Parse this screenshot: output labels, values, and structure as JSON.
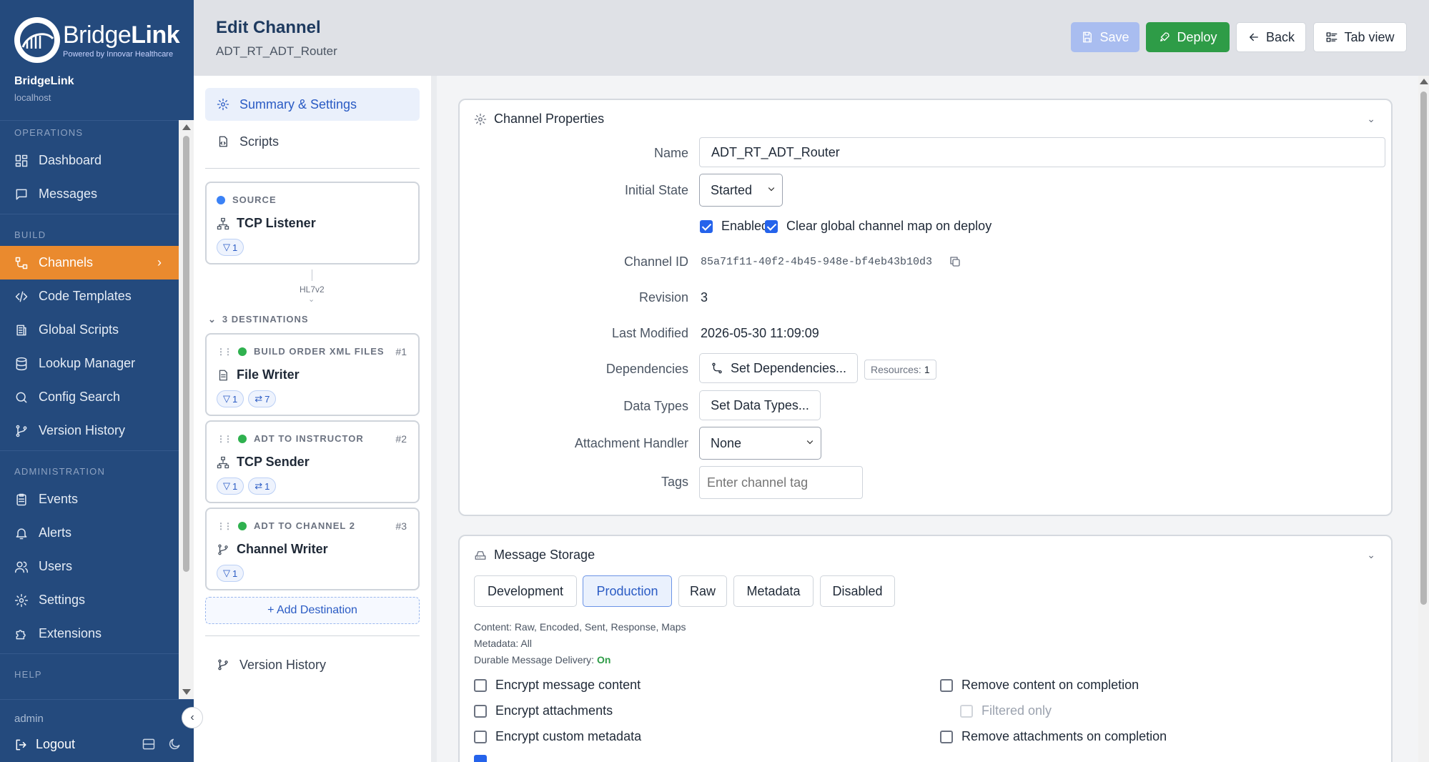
{
  "brand": {
    "name_light": "Bridge",
    "name_bold": "Link",
    "tagline": "Powered by Innovar Healthcare"
  },
  "server": {
    "name": "BridgeLink",
    "host": "localhost"
  },
  "sidebar": {
    "sections": [
      {
        "title": "OPERATIONS",
        "items": [
          {
            "label": "Dashboard",
            "icon": "dashboard-icon"
          },
          {
            "label": "Messages",
            "icon": "message-icon"
          }
        ]
      },
      {
        "title": "BUILD",
        "items": [
          {
            "label": "Channels",
            "icon": "channels-icon",
            "active": true
          },
          {
            "label": "Code Templates",
            "icon": "code-icon"
          },
          {
            "label": "Global Scripts",
            "icon": "script-icon"
          },
          {
            "label": "Lookup Manager",
            "icon": "database-icon"
          },
          {
            "label": "Config Search",
            "icon": "search-icon"
          },
          {
            "label": "Version History",
            "icon": "branch-icon"
          }
        ]
      },
      {
        "title": "ADMINISTRATION",
        "items": [
          {
            "label": "Events",
            "icon": "clipboard-icon"
          },
          {
            "label": "Alerts",
            "icon": "bell-icon"
          },
          {
            "label": "Users",
            "icon": "users-icon"
          },
          {
            "label": "Settings",
            "icon": "gear-icon"
          },
          {
            "label": "Extensions",
            "icon": "puzzle-icon"
          }
        ]
      },
      {
        "title": "HELP",
        "items": []
      }
    ],
    "user": "admin",
    "logout_label": "Logout"
  },
  "header": {
    "title": "Edit Channel",
    "subtitle": "ADT_RT_ADT_Router",
    "save_label": "Save",
    "deploy_label": "Deploy",
    "back_label": "Back",
    "tabview_label": "Tab view"
  },
  "middle": {
    "tabs": {
      "summary": "Summary & Settings",
      "scripts": "Scripts"
    },
    "source": {
      "kind": "SOURCE",
      "name": "TCP Listener",
      "filters": "1",
      "color": "#3b82f6"
    },
    "connector_label": "HL7v2",
    "destinations_header": "3 DESTINATIONS",
    "destinations": [
      {
        "kind": "BUILD ORDER XML FILES",
        "num": "#1",
        "name": "File Writer",
        "filters": "1",
        "transformers": "7",
        "color": "#2fb14f"
      },
      {
        "kind": "ADT TO INSTRUCTOR",
        "num": "#2",
        "name": "TCP Sender",
        "filters": "1",
        "transformers": "1",
        "color": "#2fb14f"
      },
      {
        "kind": "ADT TO CHANNEL 2",
        "num": "#3",
        "name": "Channel Writer",
        "filters": "1",
        "color": "#2fb14f"
      }
    ],
    "add_destination": "+ Add Destination",
    "version_history": "Version History"
  },
  "channel_properties": {
    "title": "Channel Properties",
    "name_label": "Name",
    "name_value": "ADT_RT_ADT_Router",
    "initial_state_label": "Initial State",
    "initial_state_value": "Started",
    "enabled_label": "Enabled",
    "enabled": true,
    "clear_map_label": "Clear global channel map on deploy",
    "clear_map": true,
    "channel_id_label": "Channel ID",
    "channel_id": "85a71f11-40f2-4b45-948e-bf4eb43b10d3",
    "revision_label": "Revision",
    "revision": "3",
    "last_modified_label": "Last Modified",
    "last_modified": "2026-05-30 11:09:09",
    "dependencies_label": "Dependencies",
    "set_dependencies": "Set Dependencies...",
    "resources_label": "Resources:",
    "resources_count": "1",
    "data_types_label": "Data Types",
    "set_data_types": "Set Data Types...",
    "attachment_label": "Attachment Handler",
    "attachment_value": "None",
    "tags_label": "Tags",
    "tags_placeholder": "Enter channel tag"
  },
  "message_storage": {
    "title": "Message Storage",
    "modes": [
      "Development",
      "Production",
      "Raw",
      "Metadata",
      "Disabled"
    ],
    "active_mode": "Production",
    "content_line": "Content: Raw, Encoded, Sent, Response, Maps",
    "metadata_line": "Metadata: All",
    "durable_label": "Durable Message Delivery:",
    "durable_value": "On",
    "options": {
      "encrypt_content": "Encrypt message content",
      "encrypt_attachments": "Encrypt attachments",
      "encrypt_metadata": "Encrypt custom metadata",
      "remove_content": "Remove content on completion",
      "filtered_only": "Filtered only",
      "remove_attachments": "Remove attachments on completion"
    }
  },
  "colors": {
    "sidebar_bg": "#244a7d",
    "active_nav": "#ea8a2e",
    "deploy": "#2e9c47",
    "save_disabled": "#a9bdf0",
    "accent": "#2a5bc4"
  }
}
